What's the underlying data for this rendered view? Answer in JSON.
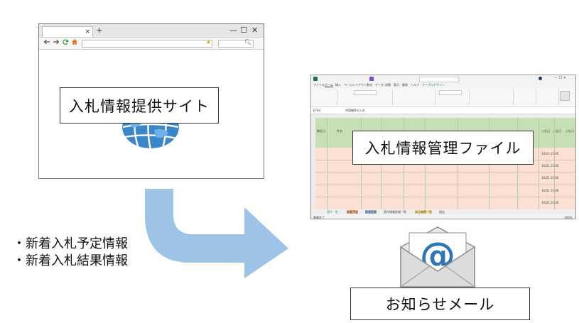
{
  "labels": {
    "site": "入札情報提供サイト",
    "excel": "入札情報管理ファイル",
    "mail": "お知らせメール"
  },
  "bullets": [
    "・新着入札予定情報",
    "・新着入札結果情報"
  ],
  "browser": {
    "tab_close": "×",
    "new_tab": "+",
    "window_controls": [
      "—",
      "☐",
      "✕"
    ],
    "nav_icons": [
      "back-icon",
      "forward-icon",
      "refresh-icon",
      "home-icon",
      "star-icon",
      "search-icon"
    ]
  },
  "excel": {
    "menu_items": [
      "ファイル",
      "ホーム",
      "挿入",
      "ページレイアウト",
      "数式",
      "データ",
      "校閲",
      "表示",
      "開発",
      "ヘルプ",
      "テーブルデザイン"
    ],
    "cell_ref": "E784",
    "formula": "停電機等の入札",
    "header_cells": [
      "開札日",
      "件名",
      "入札日",
      "入札日",
      "入札日"
    ],
    "date_cells": [
      "10/21 15:00",
      "10/21 15:00",
      "10/21 15:00",
      "10/21 15:00",
      "10/21 15:00"
    ],
    "sheet_tabs": [
      "案件一覧",
      "新着予定",
      "新着結果",
      "案件情報詳細一覧",
      "発注機関一覧",
      "設定"
    ],
    "status_left": "準備完了",
    "zoom": "100%"
  },
  "colors": {
    "arrow": "#9dc3e6",
    "globe": "#2e75b6",
    "excel_header": "#c6dfb4",
    "excel_rows": "#fbe0d4",
    "excel_green": "#217346",
    "mail_at": "#2e75b6"
  }
}
